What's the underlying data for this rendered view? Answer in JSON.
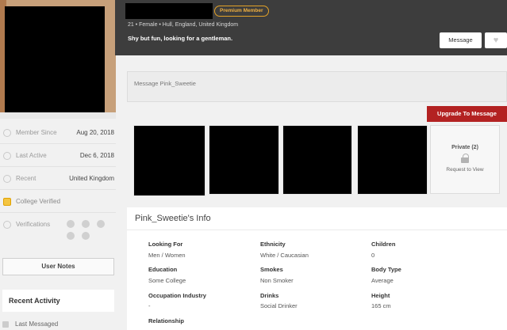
{
  "profile": {
    "premium_badge": "Premium Member",
    "meta": "21 • Female • Hull, England, United Kingdom",
    "tagline": "Shy but fun, looking for a gentleman.",
    "message_button": "Message",
    "heart_icon": "heart-icon"
  },
  "sidebar": {
    "rows": [
      {
        "label": "Member Since",
        "value": "Aug 20, 2018",
        "icon": "person-icon"
      },
      {
        "label": "Last Active",
        "value": "Dec 6, 2018",
        "icon": "clock-icon"
      },
      {
        "label": "Recent",
        "value": "United Kingdom",
        "icon": "location-pin-icon"
      },
      {
        "label": "College Verified",
        "value": "",
        "icon": "graduation-cap-icon"
      },
      {
        "label": "Verifications",
        "value": "",
        "icon": "check-circle-icon"
      }
    ],
    "user_notes": "User Notes",
    "recent_activity": "Recent Activity",
    "last_messaged": "Last Messaged"
  },
  "message": {
    "placeholder": "Message Pink_Sweetie",
    "upgrade": "Upgrade To Message"
  },
  "photos": {
    "private_title": "Private (2)",
    "private_request": "Request to View"
  },
  "info": {
    "title": "Pink_Sweetie's Info",
    "fields": [
      {
        "label": "Looking For",
        "value": "Men / Women"
      },
      {
        "label": "Ethnicity",
        "value": "White / Caucasian"
      },
      {
        "label": "Children",
        "value": "0"
      },
      {
        "label": "Education",
        "value": "Some College"
      },
      {
        "label": "Smokes",
        "value": "Non Smoker"
      },
      {
        "label": "Body Type",
        "value": "Average"
      },
      {
        "label": "Occupation Industry",
        "value": "-"
      },
      {
        "label": "Drinks",
        "value": "Social Drinker"
      },
      {
        "label": "Height",
        "value": "165 cm"
      },
      {
        "label": "Relationship",
        "value": ""
      }
    ]
  },
  "colors": {
    "header_bg": "#3d3d3d",
    "premium_gold": "#e3a228",
    "upgrade_red": "#b32222"
  }
}
